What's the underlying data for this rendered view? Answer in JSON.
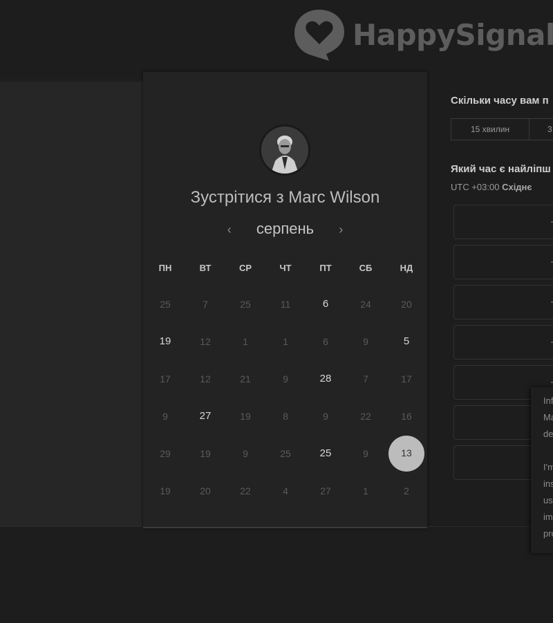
{
  "header": {
    "brand_name": "HappySignals",
    "logo_icon": "heart-speech-bubble-icon"
  },
  "card": {
    "title": "Зустрітися з Marc Wilson",
    "month": "серпень",
    "prev_icon": "chevron-left-icon",
    "next_icon": "chevron-right-icon",
    "weekdays": [
      "ПН",
      "ВТ",
      "СР",
      "ЧТ",
      "ПТ",
      "СБ",
      "НД"
    ],
    "weeks": [
      [
        "25",
        "7",
        "25",
        "11",
        "6",
        "24",
        "20"
      ],
      [
        "19",
        "12",
        "1",
        "1",
        "6",
        "9",
        "5"
      ],
      [
        "17",
        "12",
        "21",
        "9",
        "28",
        "7",
        "17"
      ],
      [
        "9",
        "27",
        "19",
        "8",
        "9",
        "22",
        "16"
      ],
      [
        "29",
        "19",
        "9",
        "25",
        "25",
        "9",
        "13"
      ],
      [
        "19",
        "20",
        "22",
        "4",
        "27",
        "1",
        "2"
      ]
    ],
    "available": [
      [
        0,
        4
      ],
      [
        1,
        0
      ],
      [
        1,
        6
      ],
      [
        2,
        4
      ],
      [
        3,
        1
      ],
      [
        4,
        4
      ]
    ],
    "selected": [
      4,
      6
    ]
  },
  "booking": {
    "duration_question": "Скільки часу вам п",
    "durations": [
      "15 хвилин",
      "3"
    ],
    "time_question": "Який час є найліпш",
    "timezone_offset": "UTC +03:00",
    "timezone_name": "Східнє"
  },
  "tooltip": {
    "lines": [
      "Inf",
      "Ma",
      "de",
      "",
      "I'm",
      "ins",
      "us",
      "im",
      "pro"
    ]
  },
  "colors": {
    "background": "#1e1e1e",
    "card": "#232323",
    "selected_day": "#bcbcbc",
    "brand_gray": "#5d5d5d"
  }
}
